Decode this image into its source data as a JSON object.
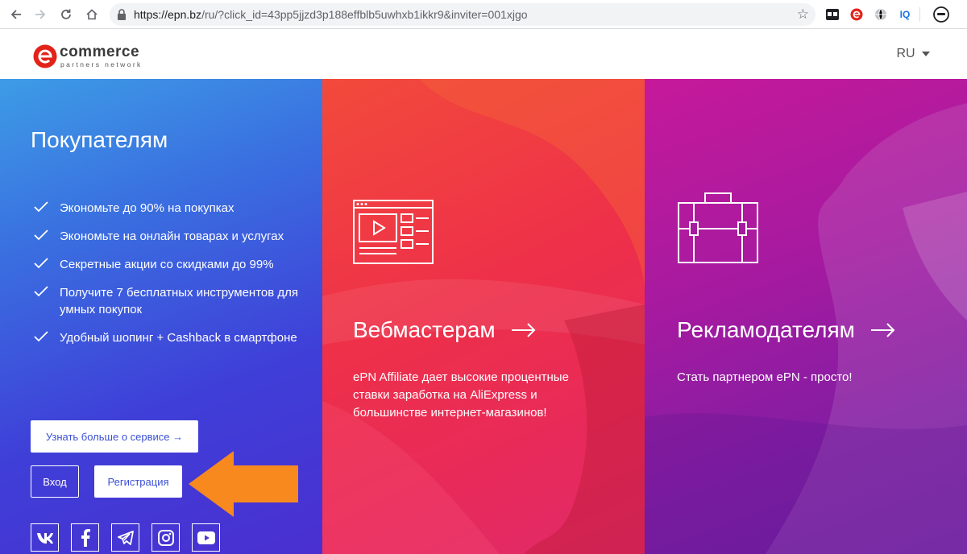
{
  "browser": {
    "url_host": "https://epn.bz",
    "url_path": "/ru/?click_id=43pp5jjzd3p188effblb5uwhxb1ikkr9&inviter=001xjgo",
    "extensions": [
      "tab-manager-icon",
      "epn-icon",
      "globe-icon",
      "IQ",
      "profile-icon"
    ],
    "ext_iq_label": "IQ"
  },
  "header": {
    "logo_main": "commerce",
    "logo_sub": "partners network",
    "lang": "RU"
  },
  "buyers": {
    "title": "Покупателям",
    "features": [
      "Экономьте до 90% на покупках",
      "Экономьте на онлайн товарах и услугах",
      "Секретные акции со скидками до 99%",
      "Получите 7 бесплатных инструментов для умных покупок",
      "Удобный шопинг + Cashback в смартфоне"
    ],
    "learn_more": "Узнать больше о сервисе →",
    "login": "Вход",
    "register": "Регистрация",
    "socials": [
      "vk-icon",
      "facebook-icon",
      "telegram-icon",
      "instagram-icon",
      "youtube-icon"
    ]
  },
  "webmasters": {
    "title": "Вебмастерам",
    "icon": "web-layout-icon",
    "desc": "ePN Affiliate дает высокие процентные ставки заработка на AliExpress и большинстве интернет-магазинов!"
  },
  "advertisers": {
    "title": "Рекламодателям",
    "icon": "briefcase-icon",
    "desc": "Стать партнером ePN - просто!"
  },
  "colors": {
    "brand_red": "#e2231a",
    "blue_panel": "#3f4fd8",
    "red_panel": "#ee3049",
    "purple_panel": "#a61aa0",
    "accent_orange": "#f7891f"
  }
}
